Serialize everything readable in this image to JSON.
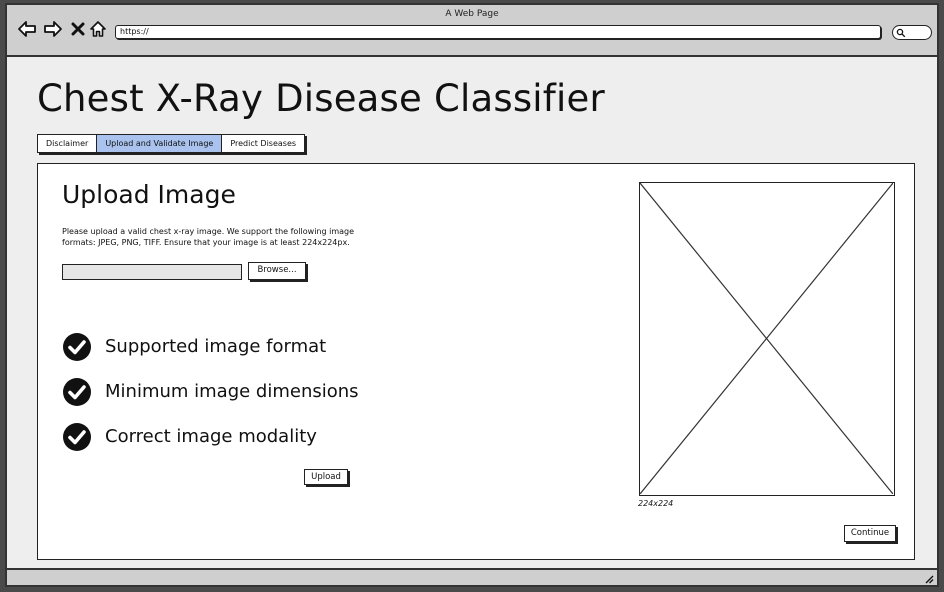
{
  "browser": {
    "window_title": "A Web Page",
    "url": "https://",
    "icons": {
      "back": "arrow-left-icon",
      "forward": "arrow-right-icon",
      "stop": "close-icon",
      "home": "home-icon",
      "search": "search-icon"
    }
  },
  "page": {
    "title": "Chest X-Ray Disease Classifier"
  },
  "tabs": [
    {
      "label": "Disclaimer",
      "active": false
    },
    {
      "label": "Upload and Validate Image",
      "active": true
    },
    {
      "label": "Predict Diseases",
      "active": false
    }
  ],
  "upload": {
    "heading": "Upload Image",
    "instructions": "Please upload a valid chest x-ray image. We support the following image formats: JPEG, PNG, TIFF. Ensure that your image is at least 224x224px.",
    "file_value": "",
    "browse_label": "Browse...",
    "upload_label": "Upload",
    "checks": [
      {
        "label": "Supported image format",
        "icon": "check-circle-icon"
      },
      {
        "label": "Minimum image dimensions",
        "icon": "check-circle-icon"
      },
      {
        "label": "Correct image modality",
        "icon": "check-circle-icon"
      }
    ]
  },
  "preview": {
    "caption": "224x224"
  },
  "footer": {
    "continue_label": "Continue"
  },
  "colors": {
    "active_tab": "#a9c3ee",
    "chrome": "#cfcfcf",
    "page_bg": "#eeeeee"
  }
}
